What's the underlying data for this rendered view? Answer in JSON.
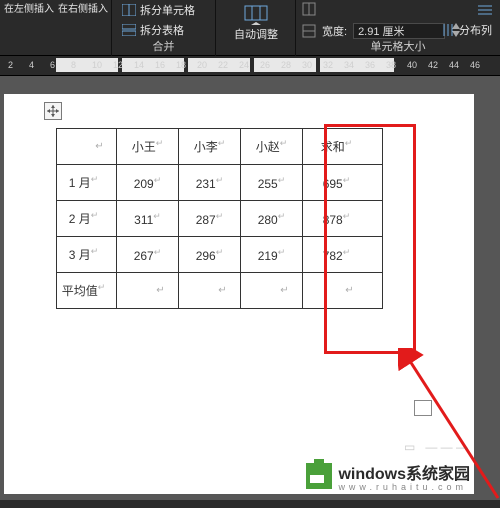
{
  "ribbon": {
    "insert": {
      "left": "在左侧插入",
      "right": "在右侧插入"
    },
    "merge": {
      "split_cells": "拆分单元格",
      "split_table": "拆分表格",
      "group_label": "合并"
    },
    "autofit": {
      "label": "自动调整"
    },
    "size": {
      "width_label": "宽度:",
      "width_value": "2.91 厘米",
      "distribute_cols": "分布列",
      "group_label": "单元格大小"
    }
  },
  "ruler": {
    "marks": [
      "2",
      "4",
      "6",
      "8",
      "10",
      "12",
      "14",
      "16",
      "18",
      "20",
      "22",
      "24",
      "26",
      "28",
      "30",
      "32",
      "34",
      "36",
      "38",
      "40",
      "42",
      "44",
      "46"
    ]
  },
  "table": {
    "headers": [
      "",
      "小王",
      "小李",
      "小赵",
      "求和"
    ],
    "rows": [
      {
        "label": "1 月",
        "cells": [
          "209",
          "231",
          "255",
          "695"
        ]
      },
      {
        "label": "2 月",
        "cells": [
          "311",
          "287",
          "280",
          "878"
        ]
      },
      {
        "label": "3 月",
        "cells": [
          "267",
          "296",
          "219",
          "782"
        ]
      },
      {
        "label": "平均值",
        "cells": [
          "",
          "",
          "",
          ""
        ]
      }
    ]
  },
  "watermark": {
    "brand": "windows系统家园",
    "url": "www.ruhaitu.com"
  }
}
